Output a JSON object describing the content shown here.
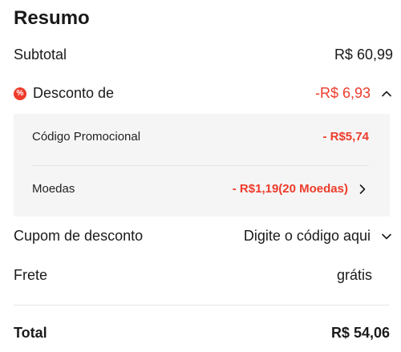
{
  "summary": {
    "title": "Resumo",
    "subtotal_label": "Subtotal",
    "subtotal_value": "R$ 60,99",
    "discount_icon": "%",
    "discount_label": "Desconto de",
    "discount_value": "-R$ 6,93",
    "promo_label": "Código Promocional",
    "promo_value": "- R$5,74",
    "coins_label": "Moedas",
    "coins_value": "- R$1,19(20 Moedas)",
    "coupon_label": "Cupom de desconto",
    "coupon_placeholder": "Digite o código aqui",
    "shipping_label": "Frete",
    "shipping_value": "grátis",
    "total_label": "Total",
    "total_value": "R$ 54,06"
  },
  "colors": {
    "discount_red": "#ee3b2b",
    "panel_bg": "#f5f5f5"
  },
  "icons": {
    "discount": "discount-badge-icon",
    "collapse": "chevron-up-icon",
    "coins_more": "chevron-right-icon",
    "coupon_expand": "chevron-down-icon"
  }
}
